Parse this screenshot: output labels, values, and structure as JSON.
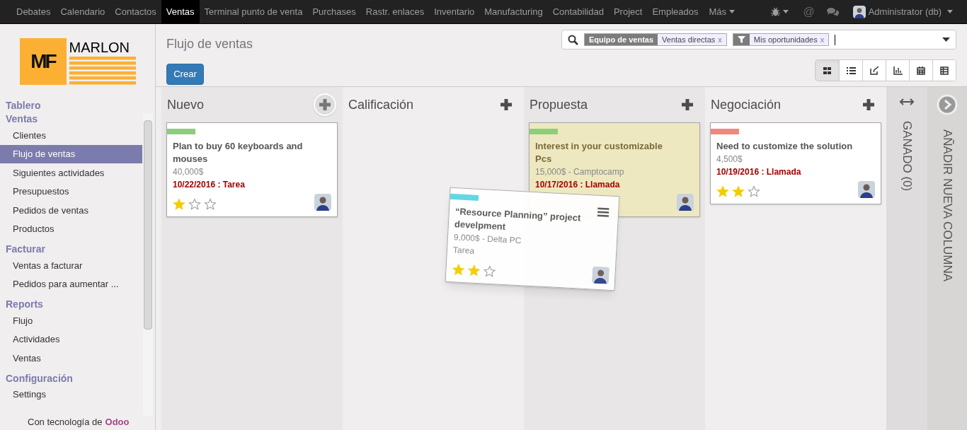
{
  "top_nav": {
    "items": [
      {
        "label": "Debates",
        "selected": false
      },
      {
        "label": "Calendario",
        "selected": false
      },
      {
        "label": "Contactos",
        "selected": false
      },
      {
        "label": "Ventas",
        "selected": true
      },
      {
        "label": "Terminal punto de venta",
        "selected": false
      },
      {
        "label": "Purchases",
        "selected": false
      },
      {
        "label": "Rastr. enlaces",
        "selected": false
      },
      {
        "label": "Inventario",
        "selected": false
      },
      {
        "label": "Manufacturing",
        "selected": false
      },
      {
        "label": "Contabilidad",
        "selected": false
      },
      {
        "label": "Project",
        "selected": false
      },
      {
        "label": "Empleados",
        "selected": false
      }
    ],
    "more": "Más",
    "mention": "@",
    "user": "Administrator (db)"
  },
  "logo": {
    "mark": "MF",
    "name": "MARLON"
  },
  "sidebar": {
    "sections": [
      {
        "heading": "Tablero"
      },
      {
        "heading": "Ventas",
        "items": [
          {
            "label": "Clientes",
            "selected": false
          },
          {
            "label": "Flujo de ventas",
            "selected": true
          },
          {
            "label": "Siguientes actividades",
            "selected": false
          },
          {
            "label": "Presupuestos",
            "selected": false
          },
          {
            "label": "Pedidos de ventas",
            "selected": false
          },
          {
            "label": "Productos",
            "selected": false
          }
        ]
      },
      {
        "heading": "Facturar",
        "items": [
          {
            "label": "Ventas a facturar",
            "selected": false
          },
          {
            "label": "Pedidos para aumentar ...",
            "selected": false
          }
        ]
      },
      {
        "heading": "Reports",
        "items": [
          {
            "label": "Flujo",
            "selected": false
          },
          {
            "label": "Actividades",
            "selected": false
          },
          {
            "label": "Ventas",
            "selected": false
          }
        ]
      },
      {
        "heading": "Configuración",
        "items": [
          {
            "label": "Settings",
            "selected": false
          }
        ]
      }
    ],
    "footer": {
      "prefix": "Con tecnología de",
      "brand": "Odoo"
    }
  },
  "page_title": "Flujo de ventas",
  "create_button": "Crear",
  "search": {
    "facets": [
      {
        "kind": "group",
        "label": "Equipo de ventas",
        "value": "Ventas directas",
        "remove": "x"
      },
      {
        "kind": "filter",
        "value": "Mis oportunidades",
        "remove": "x"
      }
    ]
  },
  "views": [
    {
      "kind": "kanban",
      "selected": true
    },
    {
      "kind": "list",
      "selected": false
    },
    {
      "kind": "form",
      "selected": false
    },
    {
      "kind": "graph",
      "selected": false
    },
    {
      "kind": "calendar",
      "selected": false
    },
    {
      "kind": "pivot",
      "selected": false
    }
  ],
  "columns": [
    {
      "title": "Nuevo",
      "add_hovered": true,
      "cards": [
        {
          "color": "#8dce7b",
          "title": "Plan to buy 60 keyboards and mouses",
          "subtitle": "40,000$",
          "activity": {
            "text": "10/22/2016 : Tarea",
            "overdue": true
          },
          "stars": 1,
          "highlighted": false
        }
      ]
    },
    {
      "title": "Calificación",
      "add_hovered": false
    },
    {
      "title": "Propuesta",
      "add_hovered": false,
      "cards": [
        {
          "color": "#8dce7b",
          "title": "Interest in your customizable Pcs",
          "subtitle": "15,000$ - Camptocamp",
          "activity": {
            "text": "10/17/2016 : Llamada",
            "overdue": true
          },
          "highlighted": true
        }
      ]
    },
    {
      "title": "Negociación",
      "add_hovered": false,
      "cards": [
        {
          "color": "#f0887c",
          "title": "Need to customize the solution",
          "subtitle": "4,500$",
          "activity": {
            "text": "10/19/2016 : Llamada",
            "overdue": true
          },
          "stars": 2,
          "highlighted": false
        }
      ]
    }
  ],
  "folded_column": {
    "title": "GANADO (0)"
  },
  "add_column": {
    "label": "AÑADIR NUEVA COLUMNA"
  },
  "dragged_card": {
    "color": "#5bd6e6",
    "title": "“Resource Planning” project develpment",
    "subtitle": "9,000$ - Delta PC",
    "activity": {
      "text": "Tarea",
      "overdue": false
    },
    "stars": 2,
    "highlighted": false
  }
}
